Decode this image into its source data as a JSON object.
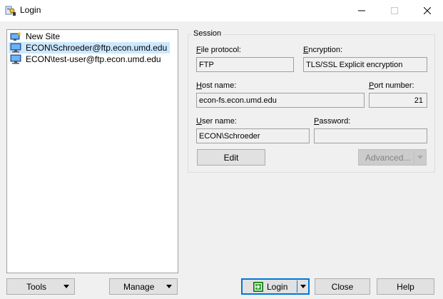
{
  "window": {
    "title": "Login",
    "icon": "winscp-login-icon",
    "controls": [
      "minimize-icon",
      "maximize-icon",
      "close-icon"
    ]
  },
  "sites": [
    {
      "label": "New Site",
      "icon": "new-site-icon",
      "selected": false
    },
    {
      "label": "ECON\\Schroeder@ftp.econ.umd.edu",
      "icon": "computer-icon",
      "selected": true
    },
    {
      "label": "ECON\\test-user@ftp.econ.umd.edu",
      "icon": "computer-icon",
      "selected": false
    }
  ],
  "session": {
    "group_title": "Session",
    "file_protocol": {
      "label_u": "F",
      "label_rest": "ile protocol:",
      "value": "FTP"
    },
    "encryption": {
      "label_u": "E",
      "label_rest": "ncryption:",
      "value": "TLS/SSL Explicit encryption"
    },
    "host_name": {
      "label_u": "H",
      "label_rest": "ost name:",
      "value": "econ-fs.econ.umd.edu"
    },
    "port_number": {
      "label_u": "P",
      "label_rest": "ort number:",
      "value": "21"
    },
    "user_name": {
      "label_u": "U",
      "label_rest": "ser name:",
      "value": "ECON\\Schroeder"
    },
    "password": {
      "label_u": "P",
      "label_rest": "assword:",
      "value": ""
    },
    "edit_label": "Edit",
    "advanced_label": "Advanced..."
  },
  "buttons": {
    "tools": "Tools",
    "manage": "Manage",
    "login": "Login",
    "close": "Close",
    "help": "Help"
  },
  "colors": {
    "selection": "#cce8ff",
    "focus_border": "#0078d7",
    "login_icon": "#3ca13c"
  }
}
